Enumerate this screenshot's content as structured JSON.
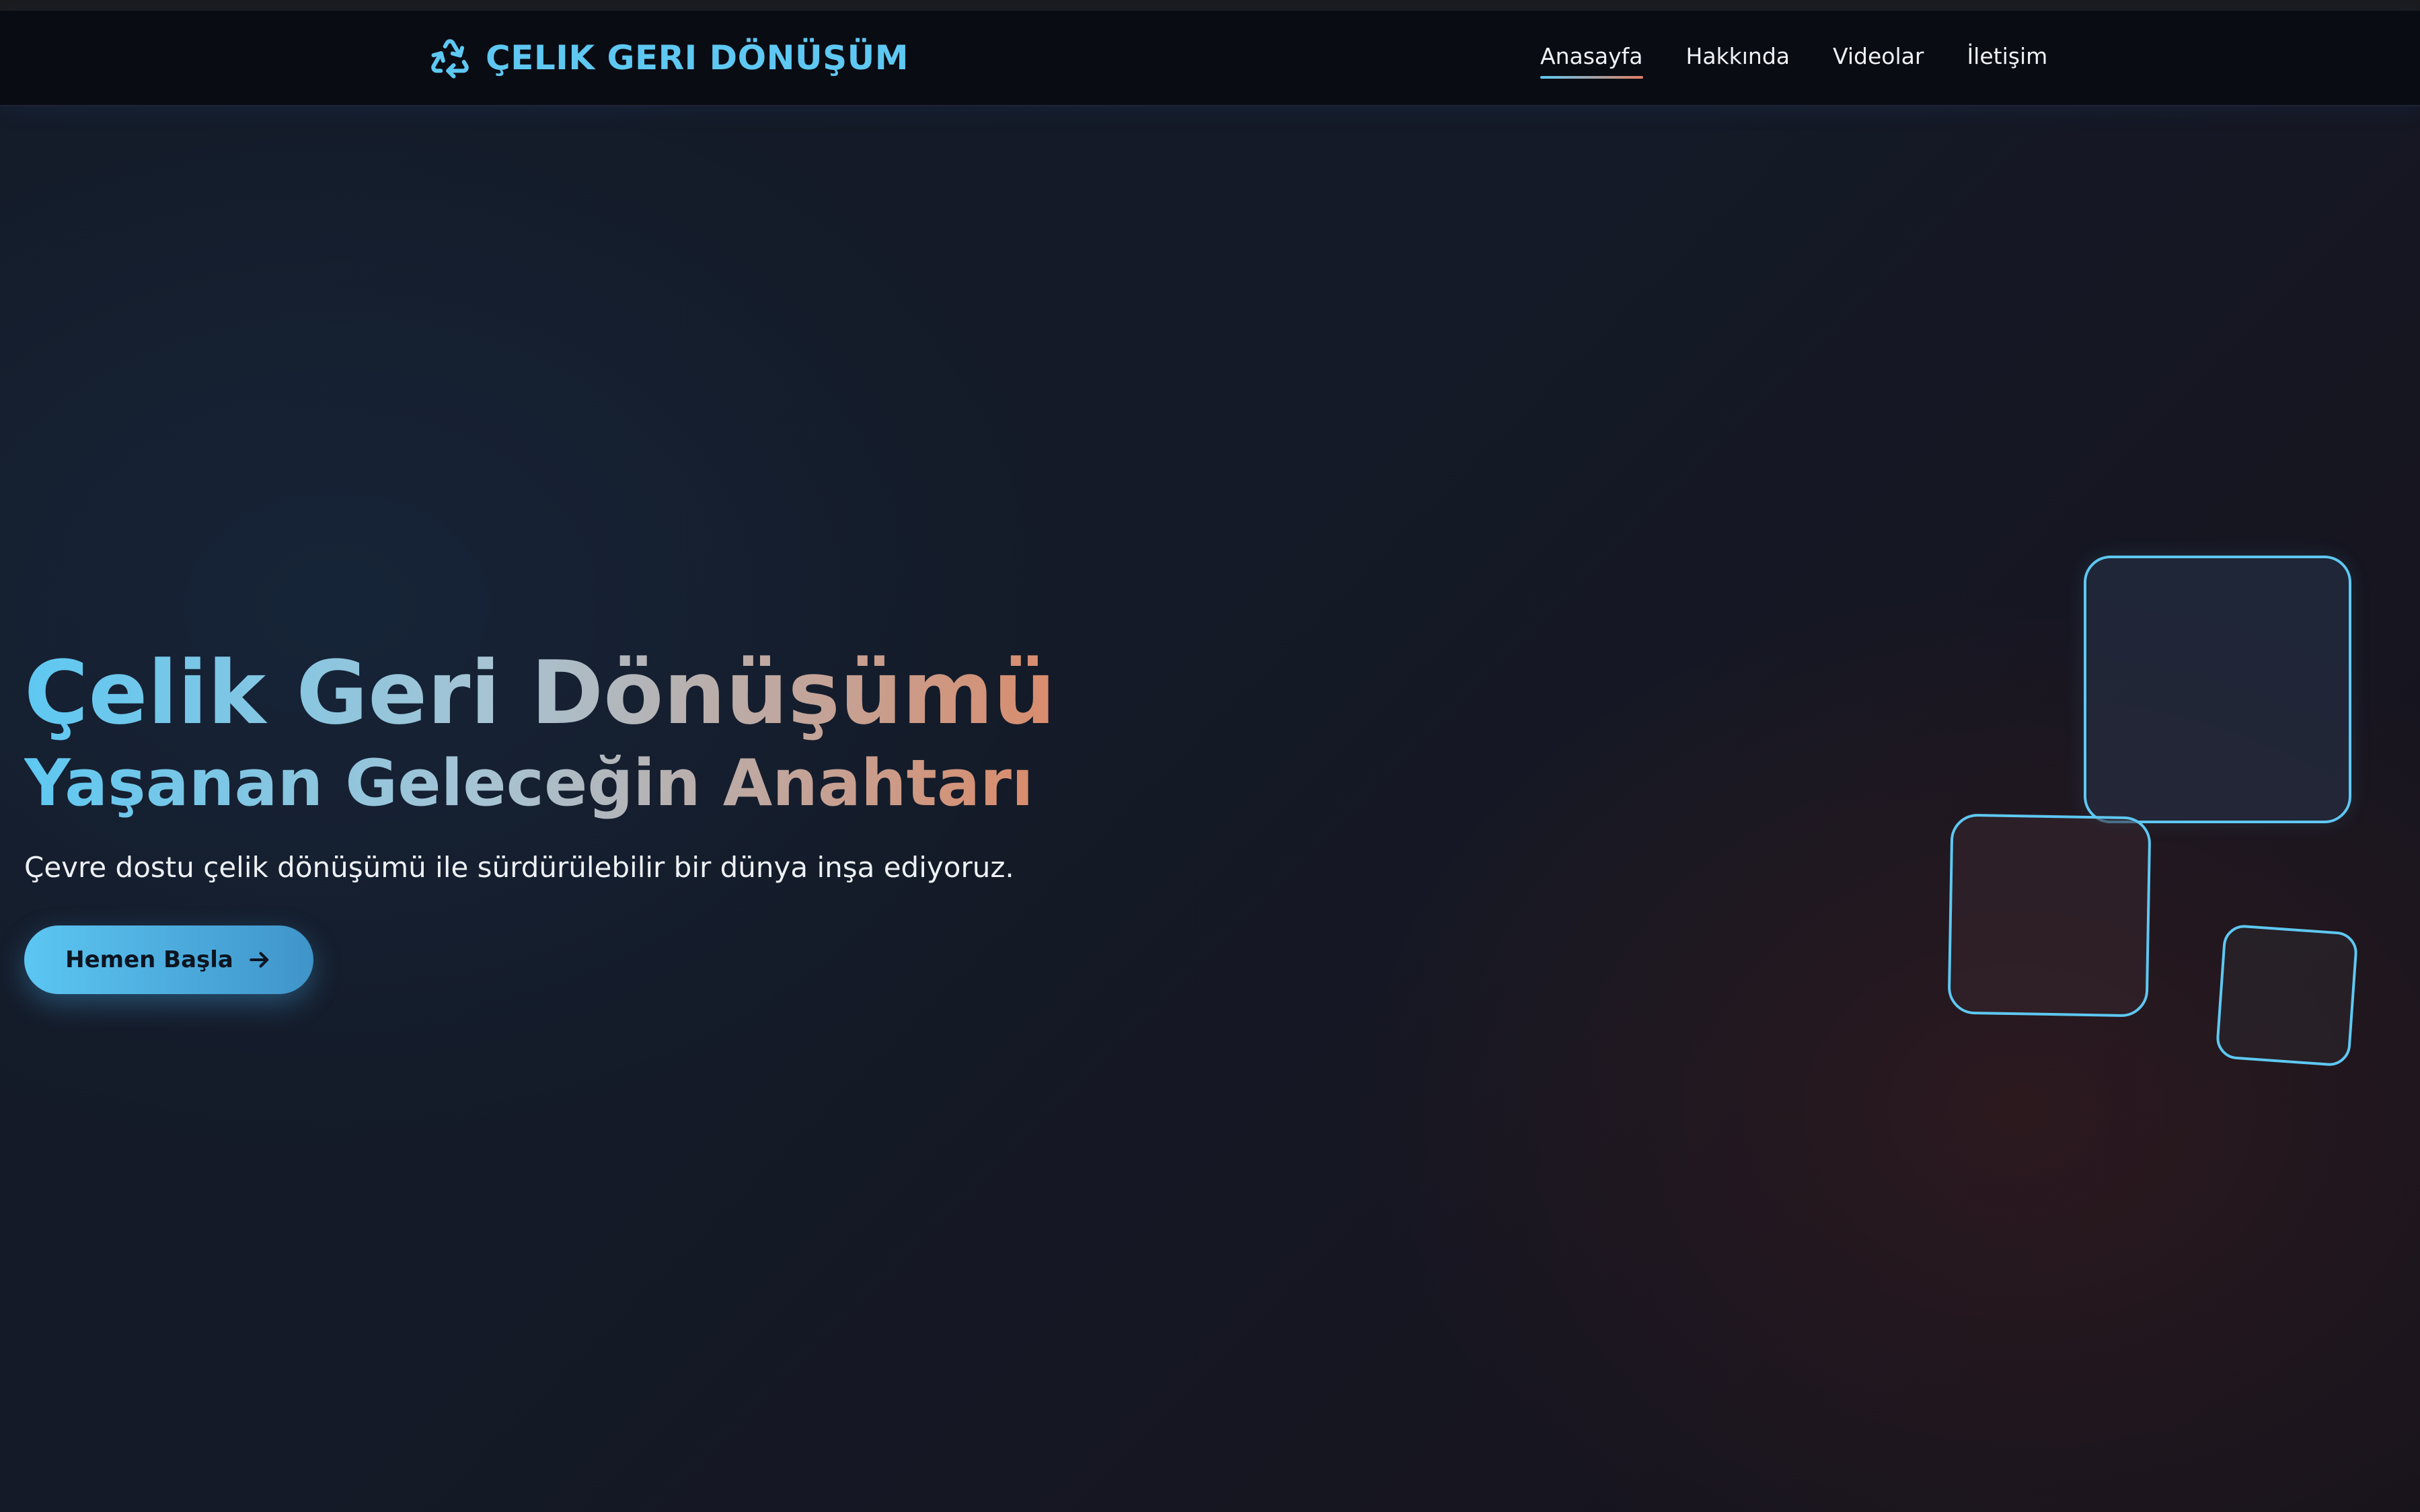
{
  "brand": {
    "name": "ÇELIK GERI DÖNÜŞÜM",
    "icon": "recycle-icon",
    "color": "#5ec8f2"
  },
  "nav": {
    "items": [
      {
        "label": "Anasayfa",
        "active": true
      },
      {
        "label": "Hakkında",
        "active": false
      },
      {
        "label": "Videolar",
        "active": false
      },
      {
        "label": "İletişim",
        "active": false
      }
    ]
  },
  "hero": {
    "title": "Çelik Geri Dönüşümü",
    "subtitle": "Yaşanan Geleceğin Anahtarı",
    "description": "Çevre dostu çelik dönüşümü ile sürdürülebilir bir dünya inşa ediyoruz.",
    "cta_label": "Hemen Başla",
    "cta_icon": "arrow-right-icon"
  },
  "colors": {
    "accent_blue": "#5ec8f2",
    "accent_orange": "#e07f62",
    "background": "#12151f"
  }
}
